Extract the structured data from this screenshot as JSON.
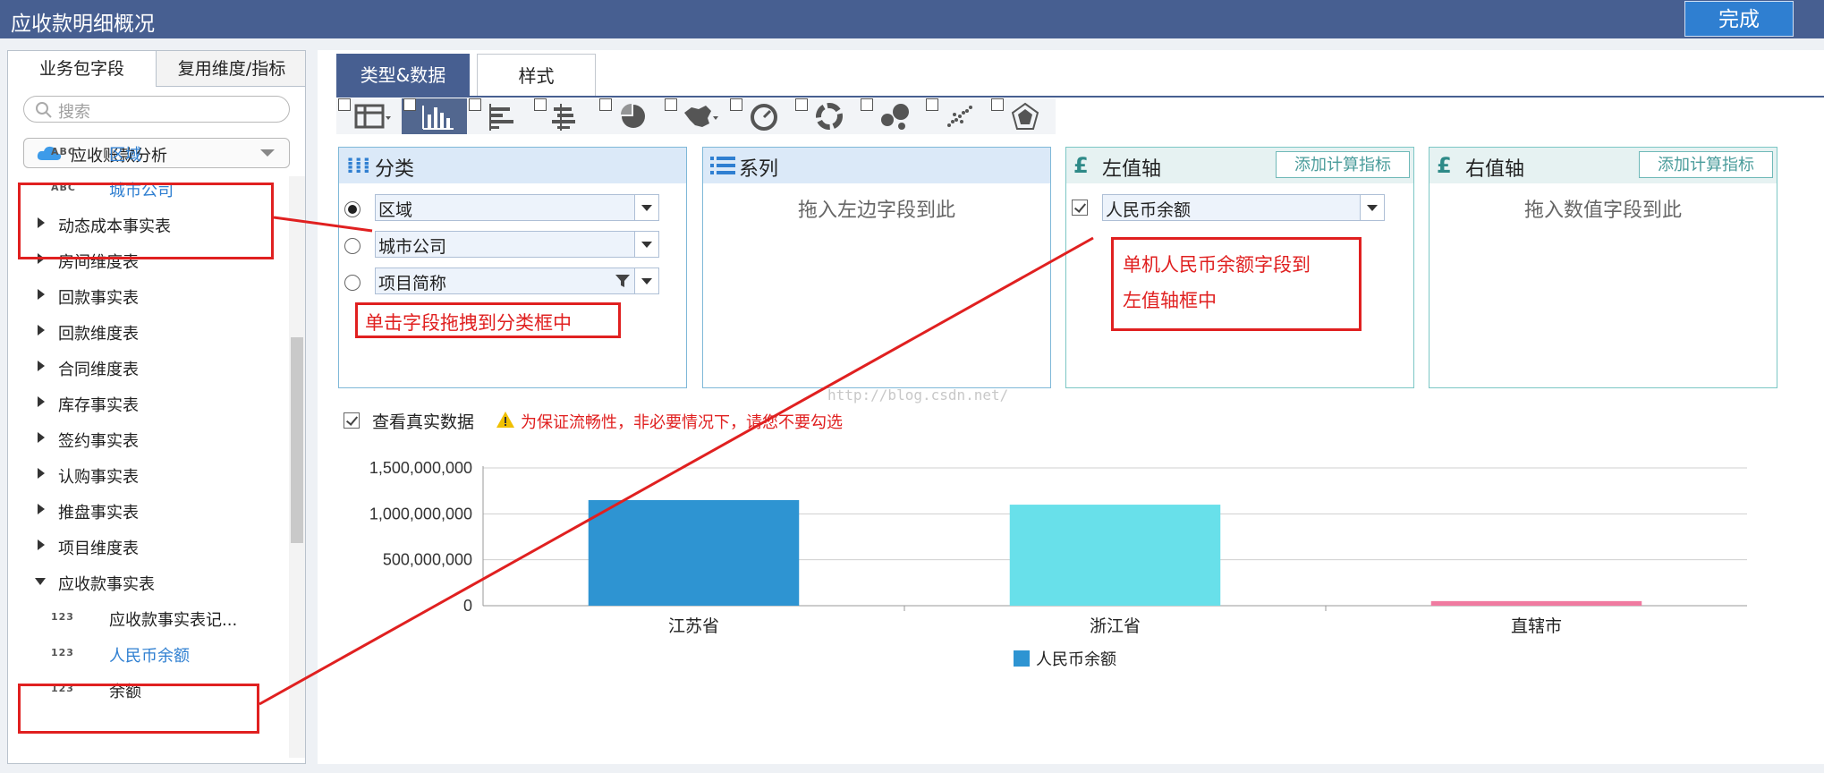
{
  "window": {
    "title": "应收款明细概况",
    "done_label": "完成"
  },
  "left_panel": {
    "tabs": [
      "业务包字段",
      "复用维度/指标"
    ],
    "search_placeholder": "搜索",
    "package": "应收账款分析",
    "fields_top": [
      {
        "tag": "ABC",
        "label": "区域"
      },
      {
        "tag": "ABC",
        "label": "城市公司"
      }
    ],
    "tables": [
      "动态成本事实表",
      "房间维度表",
      "回款事实表",
      "回款维度表",
      "合同维度表",
      "库存事实表",
      "签约事实表",
      "认购事实表",
      "推盘事实表",
      "项目维度表"
    ],
    "expanded_table": "应收款事实表",
    "fields_bottom": [
      {
        "tag": "123",
        "label": "应收款事实表记..."
      },
      {
        "tag": "123",
        "label": "人民币余额"
      },
      {
        "tag": "123",
        "label": "余额"
      }
    ]
  },
  "config_tabs": [
    "类型&数据",
    "样式"
  ],
  "chart_type_icons": [
    "table-icon",
    "bar-chart-icon",
    "horizontal-bar-icon",
    "stacked-bar-icon",
    "pie-chart-icon",
    "map-icon",
    "gauge-icon",
    "donut-icon",
    "bubble-icon",
    "scatter-icon",
    "radar-icon"
  ],
  "panels": {
    "category": {
      "title": "分类",
      "items": [
        "区域",
        "城市公司",
        "项目简称"
      ],
      "selected_index": 0
    },
    "series": {
      "title": "系列",
      "hint": "拖入左边字段到此"
    },
    "left_axis": {
      "title": "左值轴",
      "add_label": "添加计算指标",
      "field": "人民币余额"
    },
    "right_axis": {
      "title": "右值轴",
      "add_label": "添加计算指标",
      "hint": "拖入数值字段到此"
    }
  },
  "annotations": {
    "drag_category": "单击字段拖拽到分类框中",
    "left_axis_line1": "单机人民币余额字段到",
    "left_axis_line2": "左值轴框中"
  },
  "real_data": {
    "label": "查看真实数据",
    "warning": "为保证流畅性，非必要情况下，请您不要勾选"
  },
  "watermark": "http://blog.csdn.net/",
  "colors": {
    "accent": "#475f91",
    "annotation": "#e02020"
  },
  "chart_data": {
    "type": "bar",
    "categories": [
      "江苏省",
      "浙江省",
      "直辖市"
    ],
    "values": [
      1150000000,
      1100000000,
      50000000
    ],
    "bar_colors": [
      "#2e94d2",
      "#68e0ea",
      "#f07aa0"
    ],
    "series": [
      {
        "name": "人民币余额",
        "values": [
          1150000000,
          1100000000,
          50000000
        ]
      }
    ],
    "yticks": [
      "0",
      "500,000,000",
      "1,000,000,000",
      "1,500,000,000"
    ],
    "ylim": [
      0,
      1500000000
    ],
    "grid": true,
    "legend": "bottom"
  }
}
